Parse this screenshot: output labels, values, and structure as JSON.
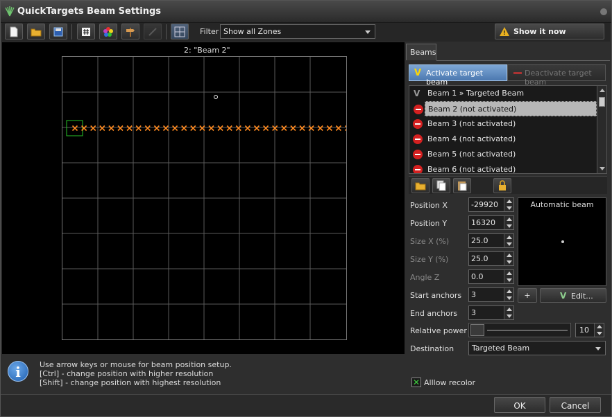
{
  "window": {
    "title": "QuickTargets Beam Settings"
  },
  "toolbar": {
    "filter_label": "Filter",
    "filter_value": "Show all Zones",
    "show_button": "Show it now",
    "buttons": [
      "new-file-icon",
      "open-folder-icon",
      "save-icon",
      "hash-icon",
      "color-wheel-icon",
      "signpost-icon",
      "draw-line-icon",
      "grid-icon"
    ]
  },
  "canvas": {
    "caption": "2: \"Beam 2\""
  },
  "info": {
    "line1": "Use arrow keys or mouse for beam position setup.",
    "line2": "[Ctrl] - change position with higher resolution",
    "line3": "[Shift] - change position with highest resolution"
  },
  "panel": {
    "tab_label": "Beams",
    "activate_label": "Activate target beam",
    "deactivate_label": "Deactivate target beam",
    "beams": [
      {
        "label": "Beam 1 » Targeted Beam",
        "state": "targeted"
      },
      {
        "label": "Beam 2 (not activated)",
        "state": "off"
      },
      {
        "label": "Beam 3 (not activated)",
        "state": "off"
      },
      {
        "label": "Beam 4 (not activated)",
        "state": "off"
      },
      {
        "label": "Beam 5 (not activated)",
        "state": "off"
      },
      {
        "label": "Beam 6 (not activated)",
        "state": "off"
      }
    ],
    "selected_beam": 1,
    "fields": {
      "pos_x_label": "Position X",
      "pos_x": "-29920",
      "pos_y_label": "Position Y",
      "pos_y": "16320",
      "size_x_label": "Size X (%)",
      "size_x": "25.0",
      "size_y_label": "Size Y (%)",
      "size_y": "25.0",
      "angle_z_label": "Angle Z",
      "angle_z": "0.0",
      "start_anchors_label": "Start anchors",
      "start_anchors": "3",
      "end_anchors_label": "End anchors",
      "end_anchors": "3",
      "relative_power_label": "Relative power",
      "relative_power": "10",
      "destination_label": "Destination",
      "destination": "Targeted Beam"
    },
    "preview_title": "Automatic beam",
    "edit_label": "Edit...",
    "recolor_label": "Alllow recolor"
  },
  "footer": {
    "ok_label": "OK",
    "cancel_label": "Cancel"
  },
  "colors": {
    "accent": "#6f96c6",
    "beam_marker": "#ff8a20",
    "selection_box": "#27c427",
    "stop_red": "#d42020"
  }
}
